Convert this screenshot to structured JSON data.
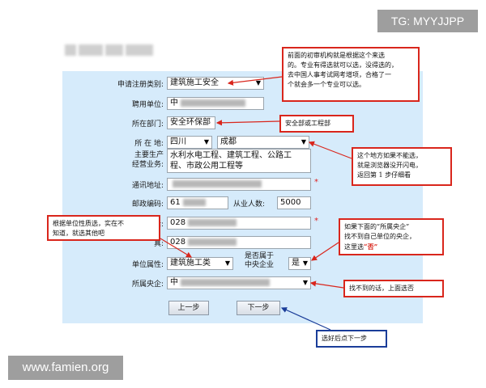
{
  "badges": {
    "tg": "TG: MYYJJPP",
    "site": "www.famien.org"
  },
  "form": {
    "register_type": {
      "label": "申请注册类别:",
      "value": "建筑施工安全"
    },
    "employer": {
      "label": "聘用单位:",
      "value": "中"
    },
    "department": {
      "label": "所在部门:",
      "value": "安全环保部"
    },
    "location": {
      "label": "所 在 地:",
      "province": "四川",
      "city": "成都"
    },
    "business": {
      "label_line1": "主要生产",
      "label_line2": "经营业务:",
      "value_line1": "水利水电工程、建筑工程、公路工",
      "value_line2": "程、市政公用工程等"
    },
    "address": {
      "label": "通讯地址:",
      "value": ""
    },
    "postcode": {
      "label": "邮政编码:",
      "value": "61",
      "staff_label": "从业人数:",
      "staff_value": "5000"
    },
    "phone": {
      "label": "话:",
      "value": "028"
    },
    "fax": {
      "label": "真:",
      "value": "028"
    },
    "unit_nature": {
      "label": "单位属性:",
      "value": "建筑施工类"
    },
    "central_enterprise_q": {
      "label_line1": "是否属于",
      "label_line2": "中央企业",
      "value": "是"
    },
    "central_enterprise": {
      "label": "所属央企:",
      "value": "中"
    },
    "required_mark": "*"
  },
  "buttons": {
    "prev": "上一步",
    "next": "下一步"
  },
  "callouts": {
    "c1": [
      "前面的初审机构就是根据这个来选",
      "的。专业有得选就可以选，没得选的，",
      "去中国人事考试网考增项，合格了一",
      "个就会多一个专业可以选。"
    ],
    "c2": "安全部或工程部",
    "c3": [
      "这个地方如果不能选，",
      "就是浏览器没开闪电，",
      "返回第 1 步仔细看"
    ],
    "c4": [
      "根据单位性质选，实在不",
      "知道，就选其他吧"
    ],
    "c5": {
      "line1": "如果下面的“所属央企”",
      "line2": "找不到自己单位的央企，",
      "line3_prefix": "这里选",
      "line3_highlight": "“否”"
    },
    "c6": "找不到的话，上面选否",
    "c7": "选好后点下一步"
  },
  "colors": {
    "panel": "#d6ebfb",
    "callout_red": "#d9261c",
    "callout_blue": "#1a3d99"
  }
}
